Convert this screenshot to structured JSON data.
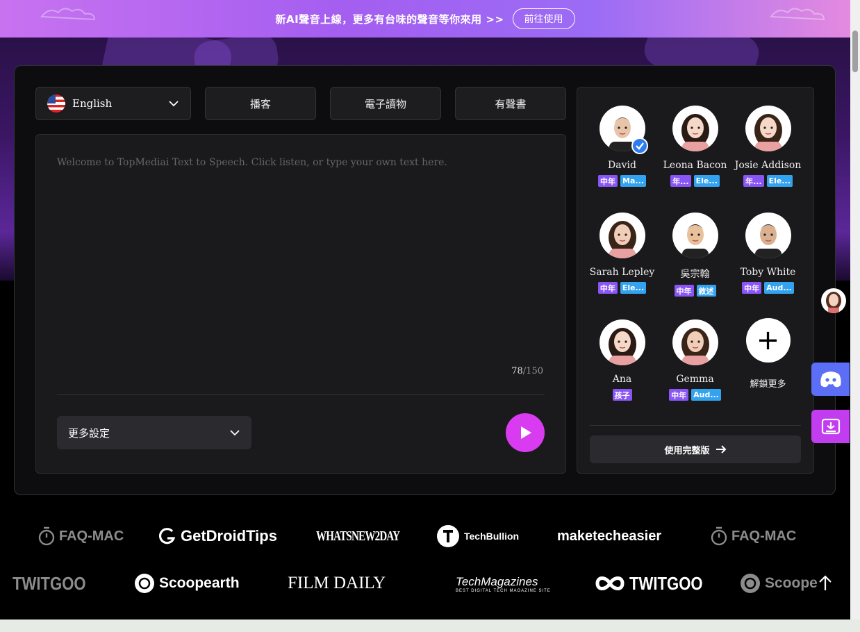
{
  "banner": {
    "text": "新AI聲音上線，更多有台味的聲音等你來用 >>",
    "button": "前往使用"
  },
  "language": {
    "label": "English"
  },
  "tabs": [
    "播客",
    "電子讀物",
    "有聲書"
  ],
  "editor": {
    "placeholder": "Welcome to TopMediai Text to Speech. Click listen, or type your own text here.",
    "count": "78",
    "limit": "/150",
    "more_settings": "更多設定"
  },
  "voices": [
    {
      "name": "David",
      "tags": [
        "中年",
        "Ma..."
      ],
      "selected": true
    },
    {
      "name": "Leona Bacon",
      "tags": [
        "年...",
        "Ele..."
      ]
    },
    {
      "name": "Josie Addison",
      "tags": [
        "年...",
        "Ele..."
      ]
    },
    {
      "name": "Sarah Lepley",
      "tags": [
        "中年",
        "Ele..."
      ]
    },
    {
      "name": "吳宗翰",
      "tags": [
        "中年",
        "敘述"
      ]
    },
    {
      "name": "Toby White",
      "tags": [
        "中年",
        "Aud..."
      ]
    },
    {
      "name": "Ana",
      "tags": [
        "孩子"
      ]
    },
    {
      "name": "Gemma",
      "tags": [
        "中年",
        "Aud..."
      ]
    }
  ],
  "unlock_more": "解鎖更多",
  "full_version": "使用完整版",
  "logos_row1": [
    "FAQ-MAC",
    "GetDroidTips",
    "WHATSNEW2DAY",
    "TechBullion",
    "maketecheasier",
    "FAQ-MAC"
  ],
  "logos_row2": [
    "TWITGOO",
    "Scoopearth",
    "FILM DAILY",
    "TechMagazines",
    "TWITGOO",
    "Scoope"
  ],
  "logo_sub": "BEST DIGITAL TECH MAGAZINE SITE",
  "colors": {
    "accent": "#d93cf0",
    "tag_purple": "#8a55f5",
    "tag_blue": "#33a3f0"
  }
}
